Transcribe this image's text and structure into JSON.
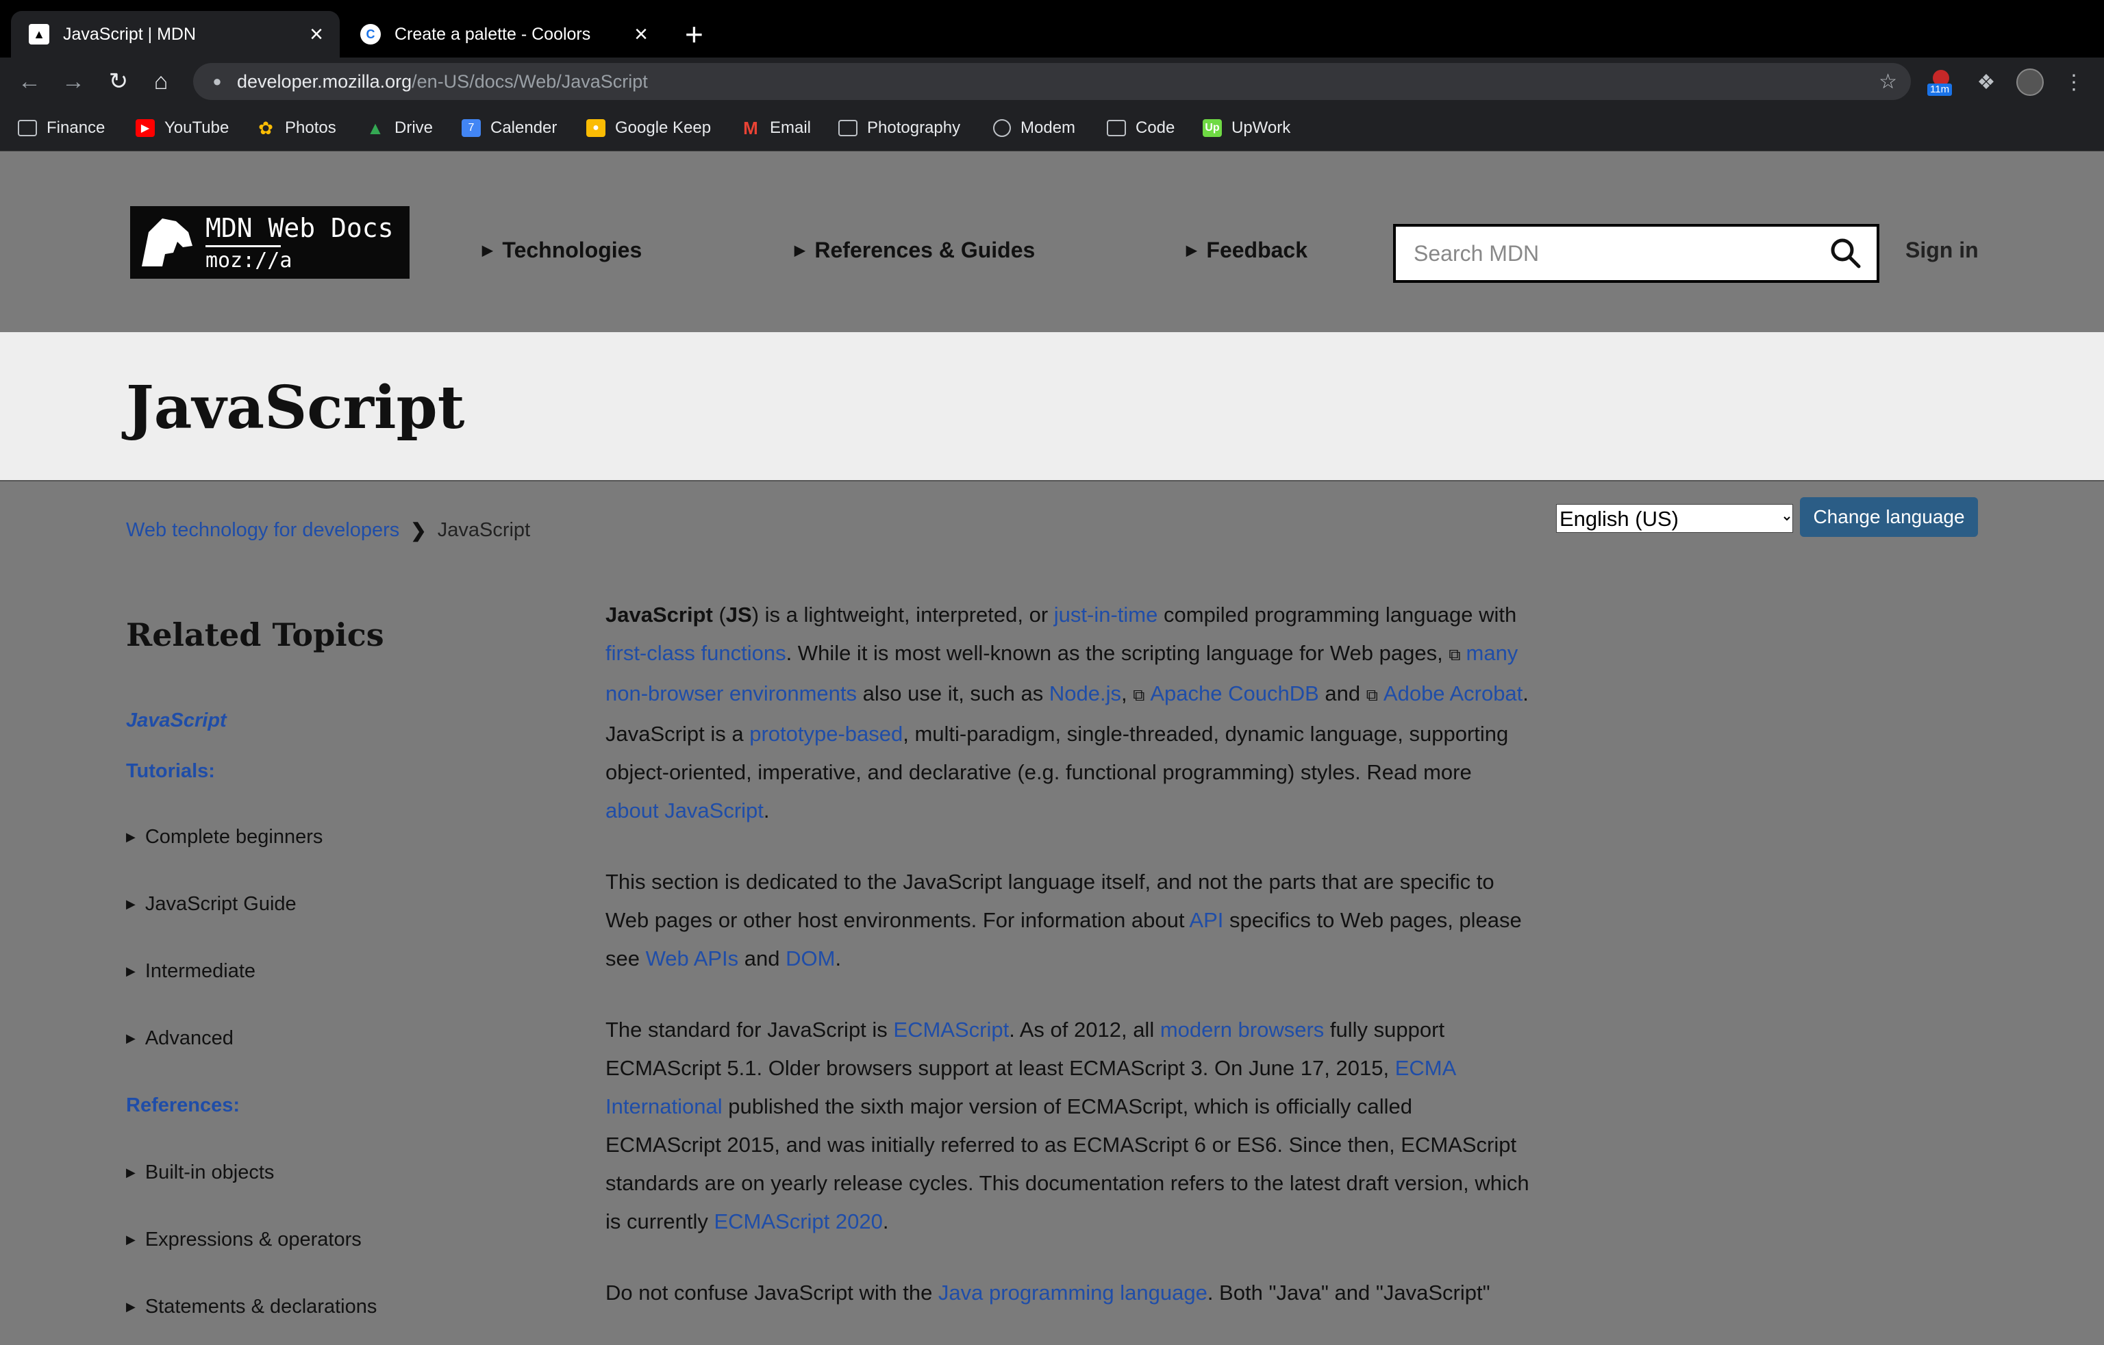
{
  "browser": {
    "tabs": [
      {
        "title": "JavaScript | MDN",
        "favicon": "mdn-dino-icon",
        "active": true
      },
      {
        "title": "Create a palette - Coolors",
        "favicon": "coolors-icon",
        "active": false
      }
    ],
    "url_domain": "developer.mozilla.org",
    "url_path": "/en-US/docs/Web/JavaScript",
    "extension_badge": "11m",
    "bookmarks": [
      {
        "label": "Finance",
        "icon": "folder-icon"
      },
      {
        "label": "YouTube",
        "icon": "youtube-icon"
      },
      {
        "label": "Photos",
        "icon": "photos-icon"
      },
      {
        "label": "Drive",
        "icon": "drive-icon"
      },
      {
        "label": "Calender",
        "icon": "calendar-icon"
      },
      {
        "label": "Google Keep",
        "icon": "keep-icon"
      },
      {
        "label": "Email",
        "icon": "gmail-icon"
      },
      {
        "label": "Photography",
        "icon": "folder-icon"
      },
      {
        "label": "Modem",
        "icon": "globe-icon"
      },
      {
        "label": "Code",
        "icon": "folder-icon"
      },
      {
        "label": "UpWork",
        "icon": "upwork-icon"
      }
    ]
  },
  "header": {
    "logo_line1": "MDN Web Docs",
    "logo_line2": "moz://a",
    "nav": [
      "Technologies",
      "References & Guides",
      "Feedback"
    ],
    "search_placeholder": "Search MDN",
    "sign_in": "Sign in"
  },
  "page": {
    "title": "JavaScript",
    "breadcrumb": {
      "parent": "Web technology for developers",
      "current": "JavaScript"
    },
    "language_selected": "English (US)",
    "change_language": "Change language"
  },
  "sidebar": {
    "heading": "Related Topics",
    "current": "JavaScript",
    "tutorials_label": "Tutorials:",
    "tutorials": [
      "Complete beginners",
      "JavaScript Guide",
      "Intermediate",
      "Advanced"
    ],
    "references_label": "References:",
    "references": [
      "Built-in objects",
      "Expressions & operators",
      "Statements & declarations"
    ]
  },
  "content": {
    "p1": {
      "js": "JavaScript",
      "t1": " (",
      "jsabbr": "JS",
      "t2": ") is a lightweight, interpreted, or ",
      "l1": "just-in-time",
      "t3": " compiled programming language with ",
      "l2": "first-class functions",
      "t4": ". While it is most well-known as the scripting language for Web pages, ",
      "l3": "many non-browser environments",
      "t5": " also use it, such as ",
      "l4": "Node.js",
      "t6": ", ",
      "l5": "Apache CouchDB",
      "t7": " and ",
      "l6": "Adobe Acrobat",
      "t8": ". JavaScript is a ",
      "l7": "prototype-based",
      "t9": ", multi-paradigm, single-threaded, dynamic language, supporting object-oriented, imperative, and declarative (e.g. functional programming) styles. Read more ",
      "l8": "about JavaScript",
      "t10": "."
    },
    "p2": {
      "t1": "This section is dedicated to the JavaScript language itself, and not the parts that are specific to Web pages or other host environments. For information about ",
      "l1": "API",
      "t2": " specifics to Web pages, please see ",
      "l2": "Web APIs",
      "t3": " and ",
      "l3": "DOM",
      "t4": "."
    },
    "p3": {
      "t1": "The standard for JavaScript is ",
      "l1": "ECMAScript",
      "t2": ". As of 2012, all ",
      "l2": "modern browsers",
      "t3": " fully support ECMAScript 5.1. Older browsers support at least ECMAScript 3. On June 17, 2015, ",
      "l3": "ECMA International",
      "t4": " published the sixth major version of ECMAScript, which is officially called ECMAScript 2015, and was initially referred to as ECMAScript 6 or ES6. Since then, ECMAScript standards are on yearly release cycles. This documentation refers to the latest draft version, which is currently ",
      "l4": "ECMAScript 2020",
      "t5": "."
    },
    "p4": {
      "t1": "Do not confuse JavaScript with the ",
      "l1": "Java programming language",
      "t2": ". Both \"Java\" and \"JavaScript\""
    }
  },
  "colors": {
    "link": "#1f4da8",
    "header_bg": "#7b7b7b",
    "title_band": "#eeeeee",
    "button": "#2b5d86"
  }
}
